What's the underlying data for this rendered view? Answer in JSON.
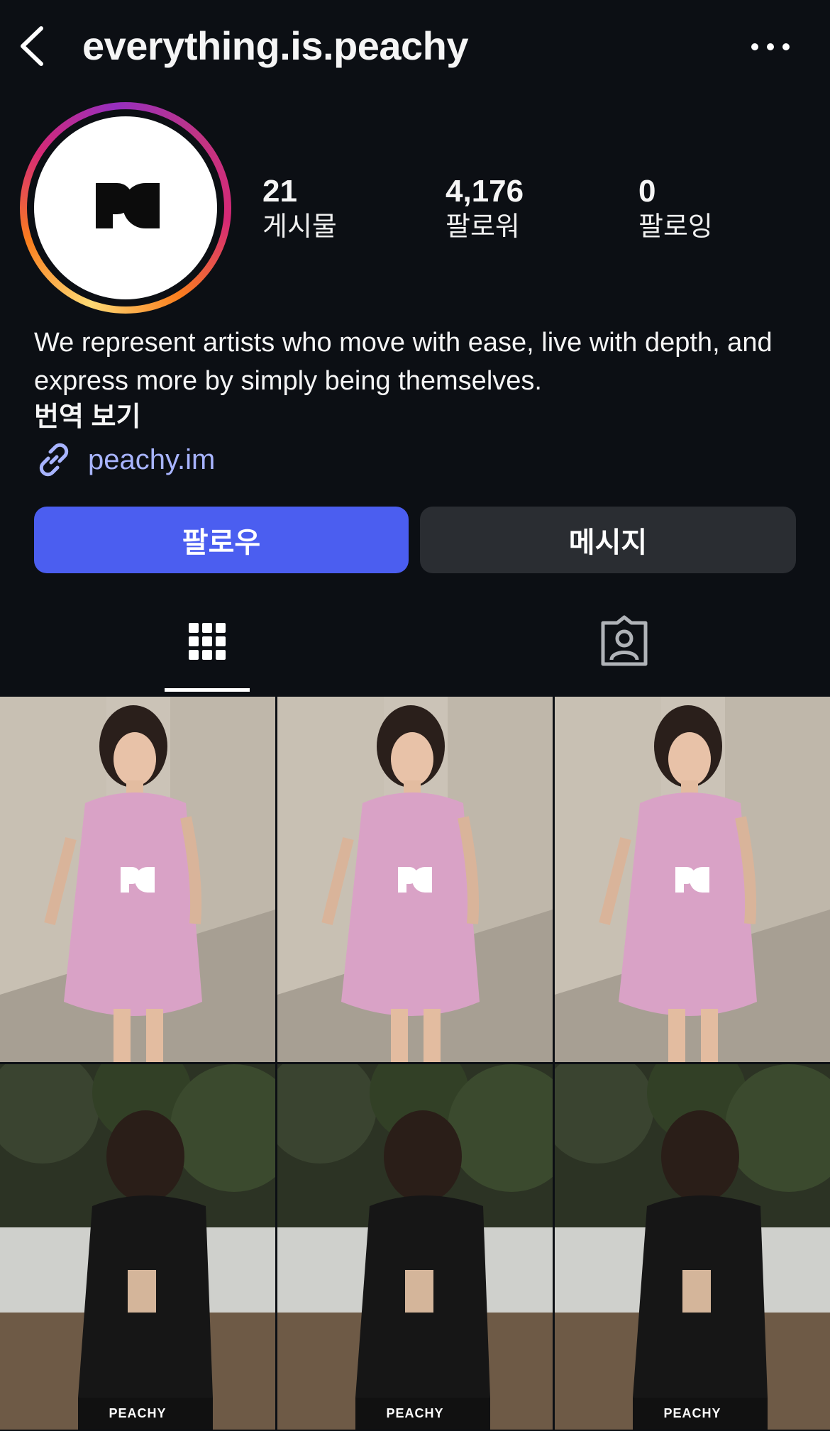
{
  "header": {
    "username": "everything.is.peachy",
    "back_icon": "chevron-left-icon",
    "more_icon": "more-horizontal-icon"
  },
  "profile": {
    "avatar_icon": "peachy-logo",
    "stats": [
      {
        "value": "21",
        "label": "게시물"
      },
      {
        "value": "4,176",
        "label": "팔로워"
      },
      {
        "value": "0",
        "label": "팔로잉"
      }
    ],
    "bio": "We represent artists who move with ease, live with depth, and express more by simply being themselves.",
    "translate_label": "번역 보기",
    "link_icon": "link-icon",
    "link_text": "peachy.im"
  },
  "actions": {
    "follow_label": "팔로우",
    "message_label": "메시지"
  },
  "tabs": {
    "grid_icon": "grid-icon",
    "tagged_icon": "tagged-person-icon",
    "active": "grid"
  },
  "grid": {
    "posts": [
      {
        "type": "photo-pink-feather-dress",
        "watermark": ""
      },
      {
        "type": "photo-pink-feather-dress",
        "watermark": ""
      },
      {
        "type": "photo-pink-feather-dress",
        "watermark": ""
      },
      {
        "type": "photo-black-leather-outfit",
        "watermark": "PEACHY"
      },
      {
        "type": "photo-black-leather-outfit",
        "watermark": "PEACHY"
      },
      {
        "type": "photo-black-leather-outfit",
        "watermark": "PEACHY"
      }
    ]
  },
  "colors": {
    "background": "#0c0f14",
    "follow_button": "#4b5ef0",
    "message_button": "#2a2d32",
    "link": "#a8b4ff"
  }
}
